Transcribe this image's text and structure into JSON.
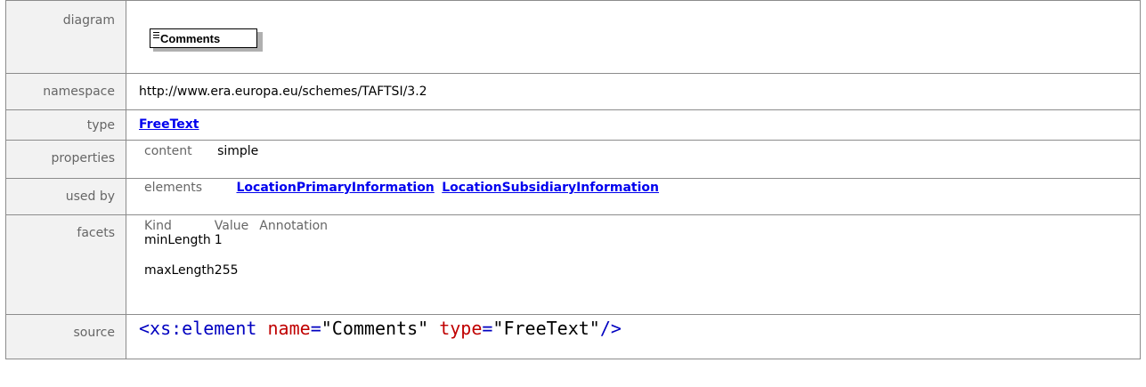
{
  "labels": {
    "diagram": "diagram",
    "namespace": "namespace",
    "type": "type",
    "properties": "properties",
    "used_by": "used by",
    "facets": "facets",
    "source": "source"
  },
  "diagram": {
    "element_name": "Comments",
    "icon": "element-lines-icon"
  },
  "namespace": "http://www.era.europa.eu/schemes/TAFTSI/3.2",
  "type": "FreeText",
  "properties": {
    "label": "content",
    "value": "simple"
  },
  "used_by": {
    "label": "elements",
    "items": [
      "LocationPrimaryInformation",
      "LocationSubsidiaryInformation"
    ]
  },
  "facets": {
    "headers": [
      "Kind",
      "Value",
      "Annotation"
    ],
    "rows": [
      {
        "kind": "minLength",
        "value": "1"
      },
      {
        "kind": "maxLength",
        "value": "255"
      }
    ]
  },
  "source": {
    "open": "<",
    "tag": "xs:element",
    "attr1": "name",
    "eq": "=",
    "val1": "\"Comments\"",
    "attr2": "type",
    "val2": "\"FreeText\"",
    "close": "/>"
  }
}
